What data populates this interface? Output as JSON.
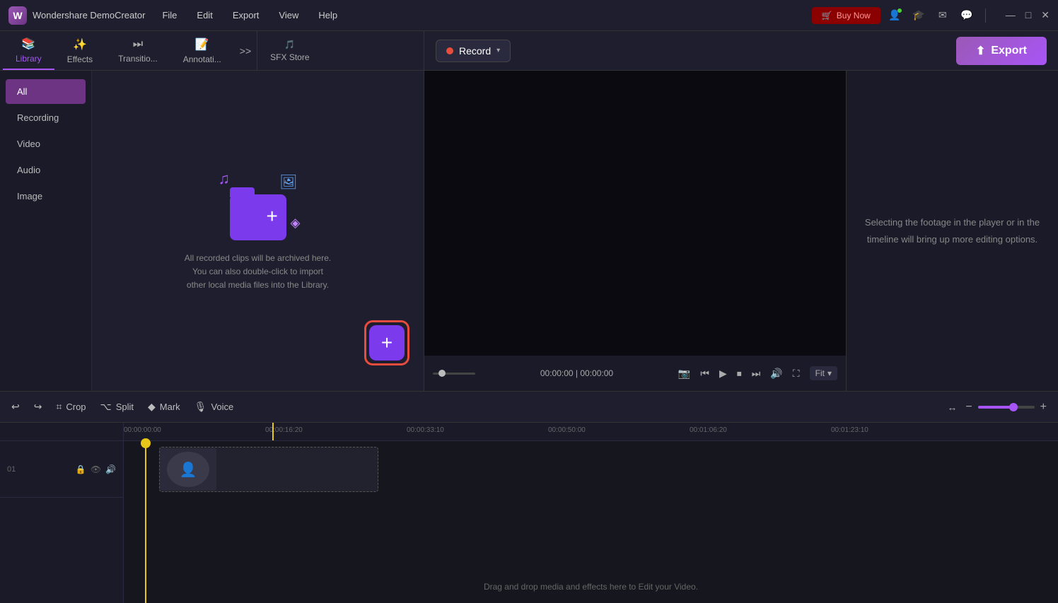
{
  "titleBar": {
    "appName": "Wondershare DemoCreator",
    "logoText": "W",
    "menu": [
      "File",
      "Edit",
      "Export",
      "View",
      "Help"
    ],
    "buyNowLabel": "Buy Now",
    "windowControls": [
      "—",
      "□",
      "✕"
    ]
  },
  "tabs": {
    "items": [
      {
        "id": "library",
        "label": "Library",
        "icon": "📚",
        "active": true
      },
      {
        "id": "effects",
        "label": "Effects",
        "icon": "✨",
        "active": false
      },
      {
        "id": "transitions",
        "label": "Transitio...",
        "icon": "⏭",
        "active": false
      },
      {
        "id": "annotations",
        "label": "Annotati...",
        "icon": "📝",
        "active": false
      },
      {
        "id": "sfxstore",
        "label": "SFX Store",
        "icon": "🎵",
        "active": false
      }
    ],
    "moreIcon": ">>"
  },
  "sidebar": {
    "items": [
      {
        "id": "all",
        "label": "All",
        "active": true
      },
      {
        "id": "recording",
        "label": "Recording",
        "active": false
      },
      {
        "id": "video",
        "label": "Video",
        "active": false
      },
      {
        "id": "audio",
        "label": "Audio",
        "active": false
      },
      {
        "id": "image",
        "label": "Image",
        "active": false
      }
    ]
  },
  "mediaArea": {
    "descriptionLine1": "All recorded clips will be archived here.",
    "descriptionLine2": "You can also double-click to import",
    "descriptionLine3": "other local media files into the Library.",
    "plusButtonLabel": "+"
  },
  "topBar": {
    "recordLabel": "Record",
    "exportLabel": "Export",
    "exportIcon": "↑"
  },
  "preview": {
    "timeLeft": "00:00:00",
    "timeSeparator": "|",
    "timeRight": "00:00:00",
    "fitLabel": "Fit"
  },
  "properties": {
    "hintText": "Selecting the footage in the player or in the timeline will bring up more editing options."
  },
  "timeline": {
    "toolbar": {
      "undoIcon": "↩",
      "redoIcon": "↪",
      "cropLabel": "Crop",
      "cropIcon": "⌗",
      "splitLabel": "Split",
      "splitIcon": "⌥",
      "markLabel": "Mark",
      "markIcon": "◆",
      "voiceLabel": "Voice",
      "voiceIcon": "🎙",
      "fitIcon": "↔",
      "zoomOutIcon": "−",
      "zoomInIcon": "+"
    },
    "ruler": {
      "marks": [
        "00:00:00:00",
        "00:00:16:20",
        "00:00:33:10",
        "00:00:50:00",
        "00:01:06:20",
        "00:01:23:10"
      ]
    },
    "tracks": [
      {
        "num": "01",
        "icons": [
          "🔒",
          "👁",
          "🔊"
        ]
      }
    ],
    "dragDropText": "Drag and drop media and effects here to Edit your Video."
  }
}
